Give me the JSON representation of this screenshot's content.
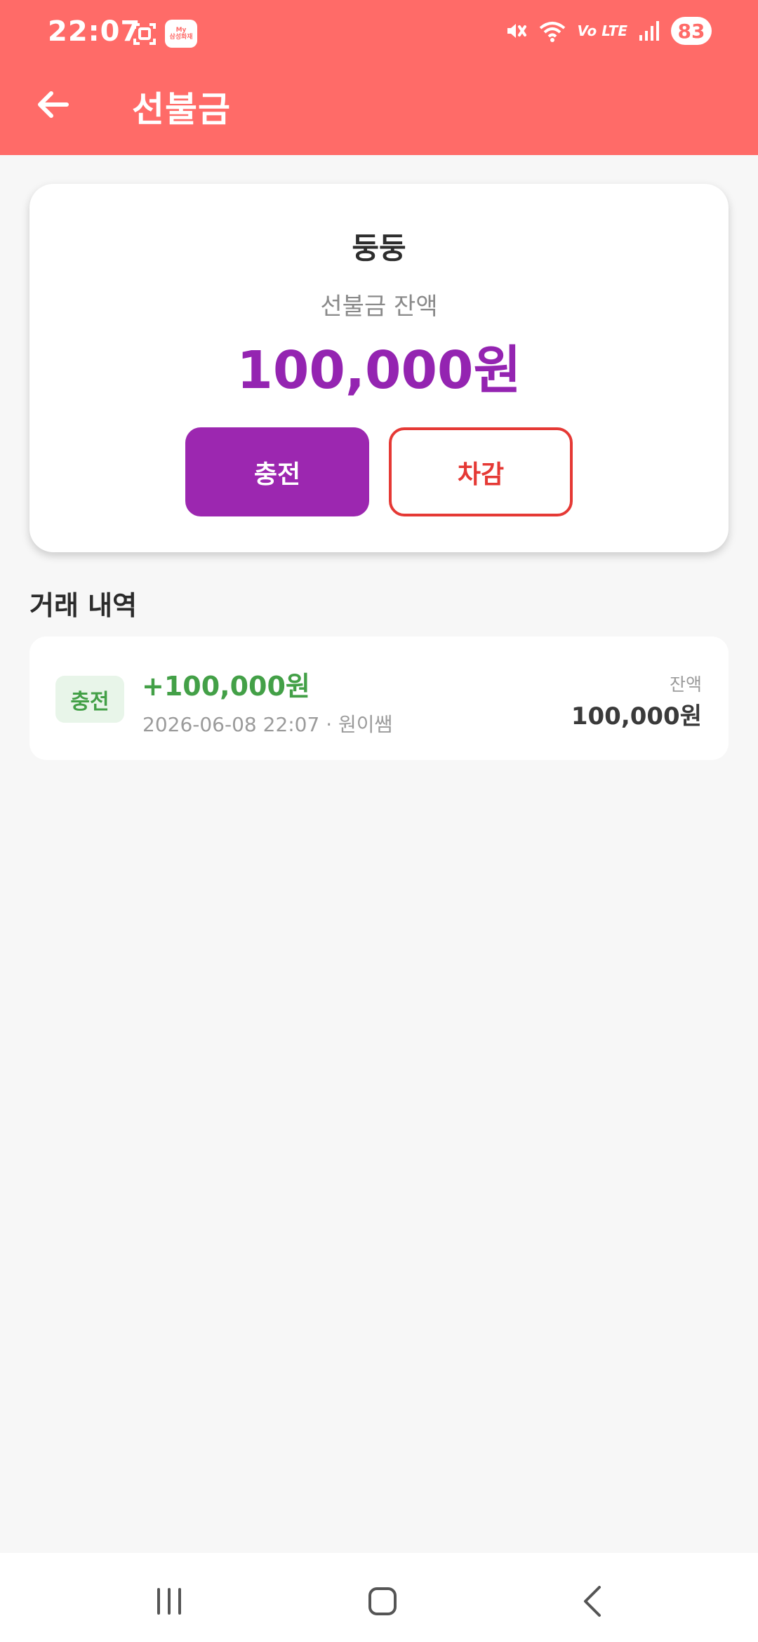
{
  "status_bar": {
    "time": "22:07",
    "app_badge_lines": [
      "My",
      "삼성화재"
    ],
    "network_text": "Vo LTE",
    "battery": "83"
  },
  "header": {
    "title": "선불금"
  },
  "balance_card": {
    "customer_name": "둥둥",
    "balance_label": "선불금 잔액",
    "balance_amount": "100,000원",
    "charge_label": "충전",
    "deduct_label": "차감"
  },
  "transactions": {
    "section_title": "거래 내역",
    "items": [
      {
        "type": "충전",
        "amount": "+100,000원",
        "meta": "2026-06-08 22:07 · 원이쌤",
        "balance_label": "잔액",
        "balance_value": "100,000원"
      }
    ]
  },
  "icons": {
    "back": "arrow-left-icon",
    "screenshot": "screen-capture-icon",
    "mute": "vibrate-off-icon",
    "wifi": "wifi-icon",
    "signal": "signal-icon",
    "nav_recents": "recent-apps-icon",
    "nav_home": "home-icon",
    "nav_back": "back-icon"
  },
  "colors": {
    "header": "#ff6b68",
    "accent": "#9424b1",
    "charge_button": "#9c27b0",
    "deduct": "#e53935",
    "success": "#43a047"
  }
}
